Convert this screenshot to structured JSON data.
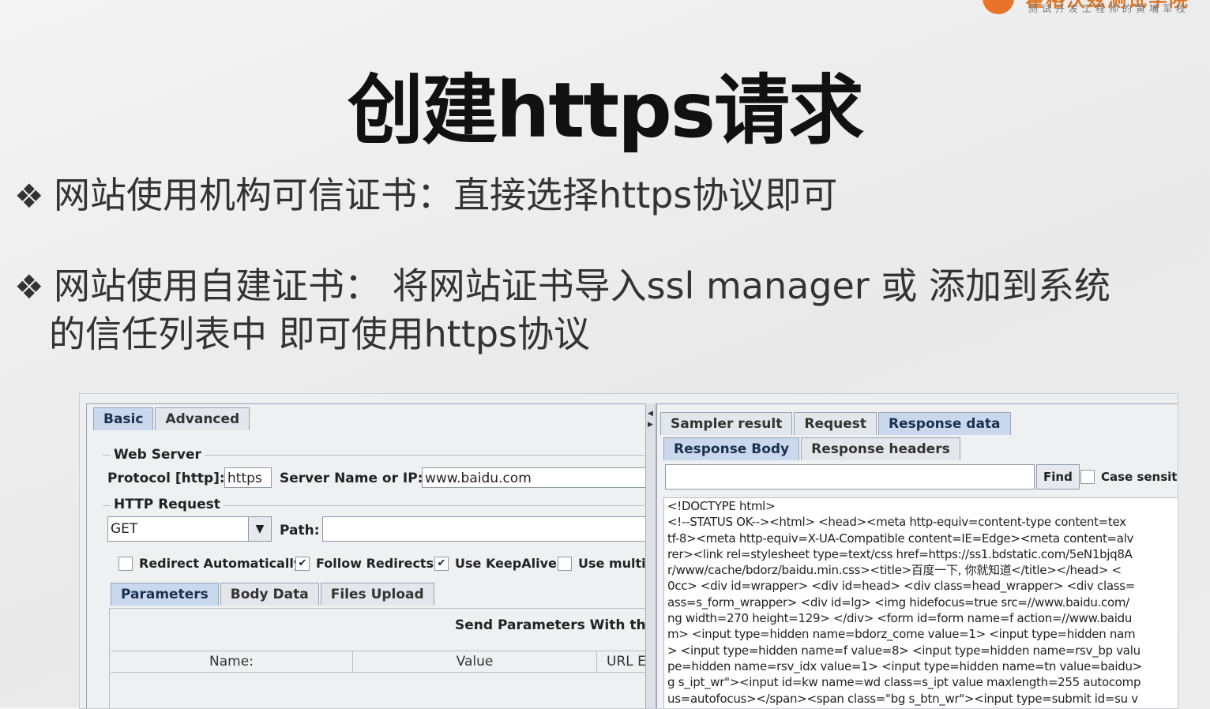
{
  "logo": {
    "name": "霍格沃兹测试学院",
    "tagline": "测试开发工程师的黄埔军校"
  },
  "slide": {
    "title": "创建https请求",
    "bullet_symbol": "❖",
    "bullet1": "网站使用机构可信证书：直接选择https协议即可",
    "bullet2_line1": "网站使用自建证书： 将网站证书导入ssl manager 或 添加到系统",
    "bullet2_line2": "的信任列表中 即可使用https协议"
  },
  "left_panel": {
    "tabs": [
      "Basic",
      "Advanced"
    ],
    "active_tab": "Basic",
    "web_server_label": "Web Server",
    "protocol_label": "Protocol [http]:",
    "protocol_value": "https",
    "server_label": "Server Name or IP:",
    "server_value": "www.baidu.com",
    "http_request_label": "HTTP Request",
    "method_value": "GET",
    "path_label": "Path:",
    "path_value": "",
    "checkboxes": [
      {
        "label": "Redirect Automatically",
        "checked": false
      },
      {
        "label": "Follow Redirects",
        "checked": true
      },
      {
        "label": "Use KeepAlive",
        "checked": true
      },
      {
        "label": "Use multip",
        "checked": false
      }
    ],
    "sub_tabs": [
      "Parameters",
      "Body Data",
      "Files Upload"
    ],
    "send_params_label": "Send Parameters With the",
    "columns": [
      "Name:",
      "Value",
      "URL E"
    ]
  },
  "right_panel": {
    "result_tabs": [
      "Sampler result",
      "Request",
      "Response data"
    ],
    "active_result_tab": "Response data",
    "body_tabs": [
      "Response Body",
      "Response headers"
    ],
    "active_body_tab": "Response Body",
    "search_value": "",
    "find_button": "Find",
    "case_sensitive_label": "Case sensitive",
    "response_lines": [
      "<!DOCTYPE html>",
      "<!--STATUS OK--><html> <head><meta http-equiv=content-type content=tex",
      "tf-8><meta http-equiv=X-UA-Compatible content=IE=Edge><meta content=alv",
      "rer><link rel=stylesheet type=text/css href=https://ss1.bdstatic.com/5eN1bjq8A",
      "r/www/cache/bdorz/baidu.min.css><title>百度一下, 你就知道</title></head> <",
      "0cc> <div id=wrapper> <div id=head> <div class=head_wrapper> <div class=",
      "ass=s_form_wrapper> <div id=lg> <img hidefocus=true src=//www.baidu.com/",
      "ng width=270 height=129> </div> <form id=form name=f action=//www.baidu",
      "m> <input type=hidden name=bdorz_come value=1> <input type=hidden nam",
      "> <input type=hidden name=f value=8> <input type=hidden name=rsv_bp valu",
      "pe=hidden name=rsv_idx value=1> <input type=hidden name=tn value=baidu>",
      "g s_ipt_wr\"><input id=kw name=wd class=s_ipt value maxlength=255 autocomp",
      "us=autofocus></span><span class=\"bg s_btn_wr\"><input type=submit id=su v"
    ]
  }
}
